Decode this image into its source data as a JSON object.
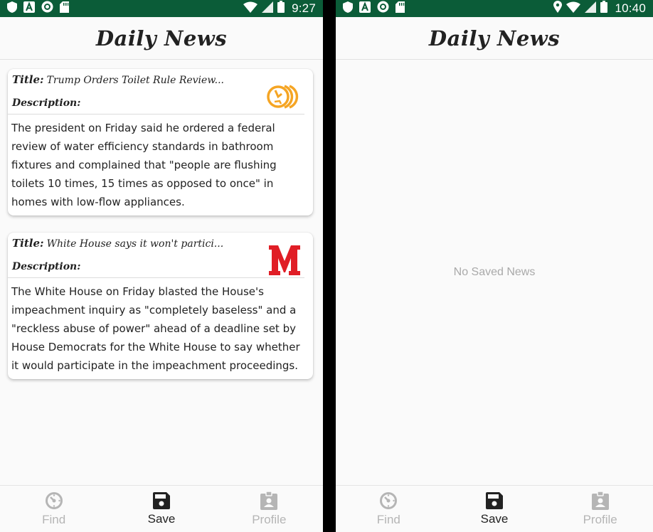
{
  "screens": [
    {
      "status_bar": {
        "time": "9:27"
      },
      "app_title": "Daily News",
      "title_label": "Title:",
      "description_label": "Description:",
      "cards": [
        {
          "title": "Trump Orders Toilet Rule Review...",
          "description": "The president on Friday said he ordered a federal review of water efficiency standards in bathroom fixtures and complained that \"people are flushing toilets 10 times, 15 times as opposed to once\" in homes with low-flow appliances.",
          "logo": "orange-circular-arrows-logo"
        },
        {
          "title": "White House says it won't partici...",
          "description": "The White House on Friday blasted the House's impeachment inquiry as \"completely baseless\" and a \"reckless abuse of power\" ahead of a deadline set by House Democrats for the White House to say whether it would participate in the impeachment proceedings.",
          "logo": "red-M-logo"
        }
      ],
      "nav": [
        {
          "label": "Find",
          "icon": "compass-icon",
          "active": false
        },
        {
          "label": "Save",
          "icon": "floppy-disk-icon",
          "active": true
        },
        {
          "label": "Profile",
          "icon": "profile-badge-icon",
          "active": false
        }
      ]
    },
    {
      "status_bar": {
        "time": "10:40"
      },
      "app_title": "Daily News",
      "empty_message": "No Saved News",
      "nav": [
        {
          "label": "Find",
          "icon": "compass-icon",
          "active": false
        },
        {
          "label": "Save",
          "icon": "floppy-disk-icon",
          "active": true
        },
        {
          "label": "Profile",
          "icon": "profile-badge-icon",
          "active": false
        }
      ]
    }
  ],
  "colors": {
    "status_bar": "#0b5c38",
    "nav_active": "#222222",
    "nav_inactive": "#b5b5b5",
    "logo_orange": "#f5a524",
    "logo_red": "#e01e26"
  }
}
